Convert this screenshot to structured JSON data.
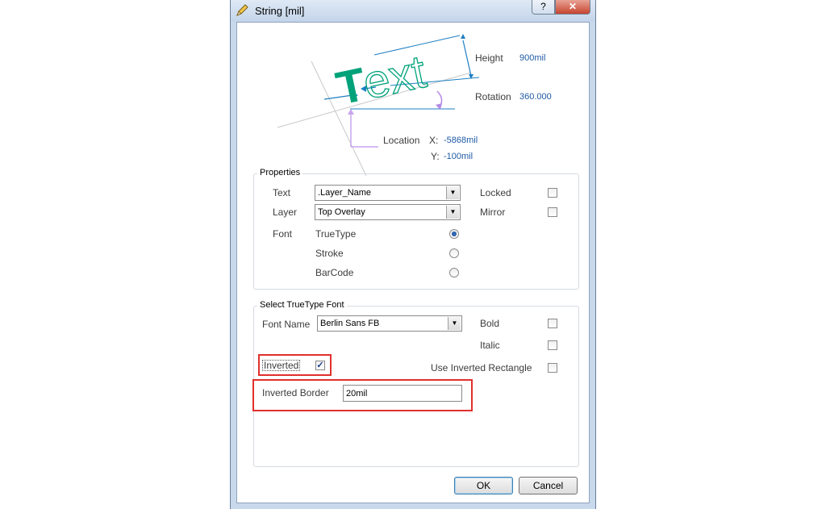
{
  "window": {
    "title": "String  [mil]",
    "help_label": "?",
    "close_label": "✕"
  },
  "icons": {
    "app": "pencil-icon",
    "help": "help-icon",
    "close": "close-icon",
    "dropdown": "chevron-down-icon",
    "check": "checkmark-icon"
  },
  "diagram": {
    "sample_text": "Text",
    "height_label": "Height",
    "height_value": "900mil",
    "rotation_label": "Rotation",
    "rotation_value": "360.000",
    "location_label": "Location",
    "x_label": "X:",
    "x_value": "-5868mil",
    "y_label": "Y:",
    "y_value": "-100mil"
  },
  "properties": {
    "group_title": "Properties",
    "text_label": "Text",
    "text_value": ".Layer_Name",
    "layer_label": "Layer",
    "layer_value": "Top Overlay",
    "font_label": "Font",
    "font_options": [
      "TrueType",
      "Stroke",
      "BarCode"
    ],
    "font_selected": "TrueType",
    "locked_label": "Locked",
    "locked": false,
    "mirror_label": "Mirror",
    "mirror": false
  },
  "truetype": {
    "group_title": "Select TrueType Font",
    "font_name_label": "Font Name",
    "font_name_value": "Berlin Sans FB",
    "bold_label": "Bold",
    "bold": false,
    "italic_label": "Italic",
    "italic": false,
    "inverted_label": "Inverted",
    "inverted": true,
    "use_inverted_rect_label": "Use Inverted Rectangle",
    "use_inverted_rect": false,
    "inverted_border_label": "Inverted Border",
    "inverted_border_value": "20mil"
  },
  "buttons": {
    "ok": "OK",
    "cancel": "Cancel"
  },
  "colors": {
    "highlight": "#e0302e",
    "accent_text": "#00a27a",
    "value_text": "#1f5aa6",
    "dimension_line": "#1e7fc4",
    "rotation_arc": "#b58ae6"
  }
}
